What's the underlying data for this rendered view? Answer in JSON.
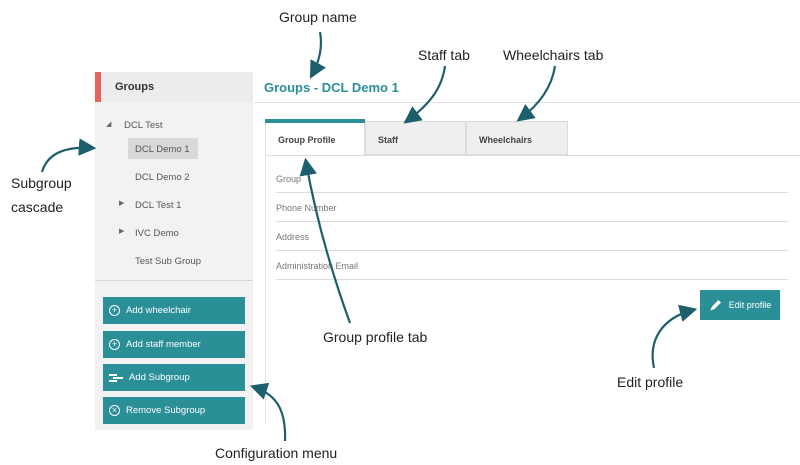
{
  "sidebar": {
    "header": "Groups",
    "tree": [
      {
        "label": "DCL Test"
      },
      {
        "label": "DCL Demo 1"
      },
      {
        "label": "DCL Demo 2"
      },
      {
        "label": "DCL Test 1"
      },
      {
        "label": "IVC Demo"
      },
      {
        "label": "Test Sub Group"
      }
    ],
    "buttons": [
      {
        "label": "Add wheelchair",
        "icon": "plus-circle-icon"
      },
      {
        "label": "Add staff member",
        "icon": "plus-circle-icon"
      },
      {
        "label": "Add Subgroup",
        "icon": "subgroup-icon"
      },
      {
        "label": "Remove Subgroup",
        "icon": "remove-circle-icon"
      }
    ]
  },
  "main": {
    "title": "Groups - DCL Demo 1",
    "tabs": [
      {
        "label": "Group Profile",
        "active": true
      },
      {
        "label": "Staff"
      },
      {
        "label": "Wheelchairs"
      }
    ],
    "fields": [
      {
        "label": "Group"
      },
      {
        "label": "Phone Number"
      },
      {
        "label": "Address"
      },
      {
        "label": "Administration Email"
      }
    ],
    "edit_button": "Edit profile",
    "accent_color": "#2b8f98",
    "header_marker_color": "#e8625f"
  },
  "annotations": {
    "group_name": "Group name",
    "staff_tab": "Staff tab",
    "wheelchairs_tab": "Wheelchairs tab",
    "subgroup_cascade_line1": "Subgroup",
    "subgroup_cascade_line2": "cascade",
    "group_profile_tab": "Group profile tab",
    "edit_profile": "Edit profile",
    "configuration_menu": "Configuration menu"
  }
}
